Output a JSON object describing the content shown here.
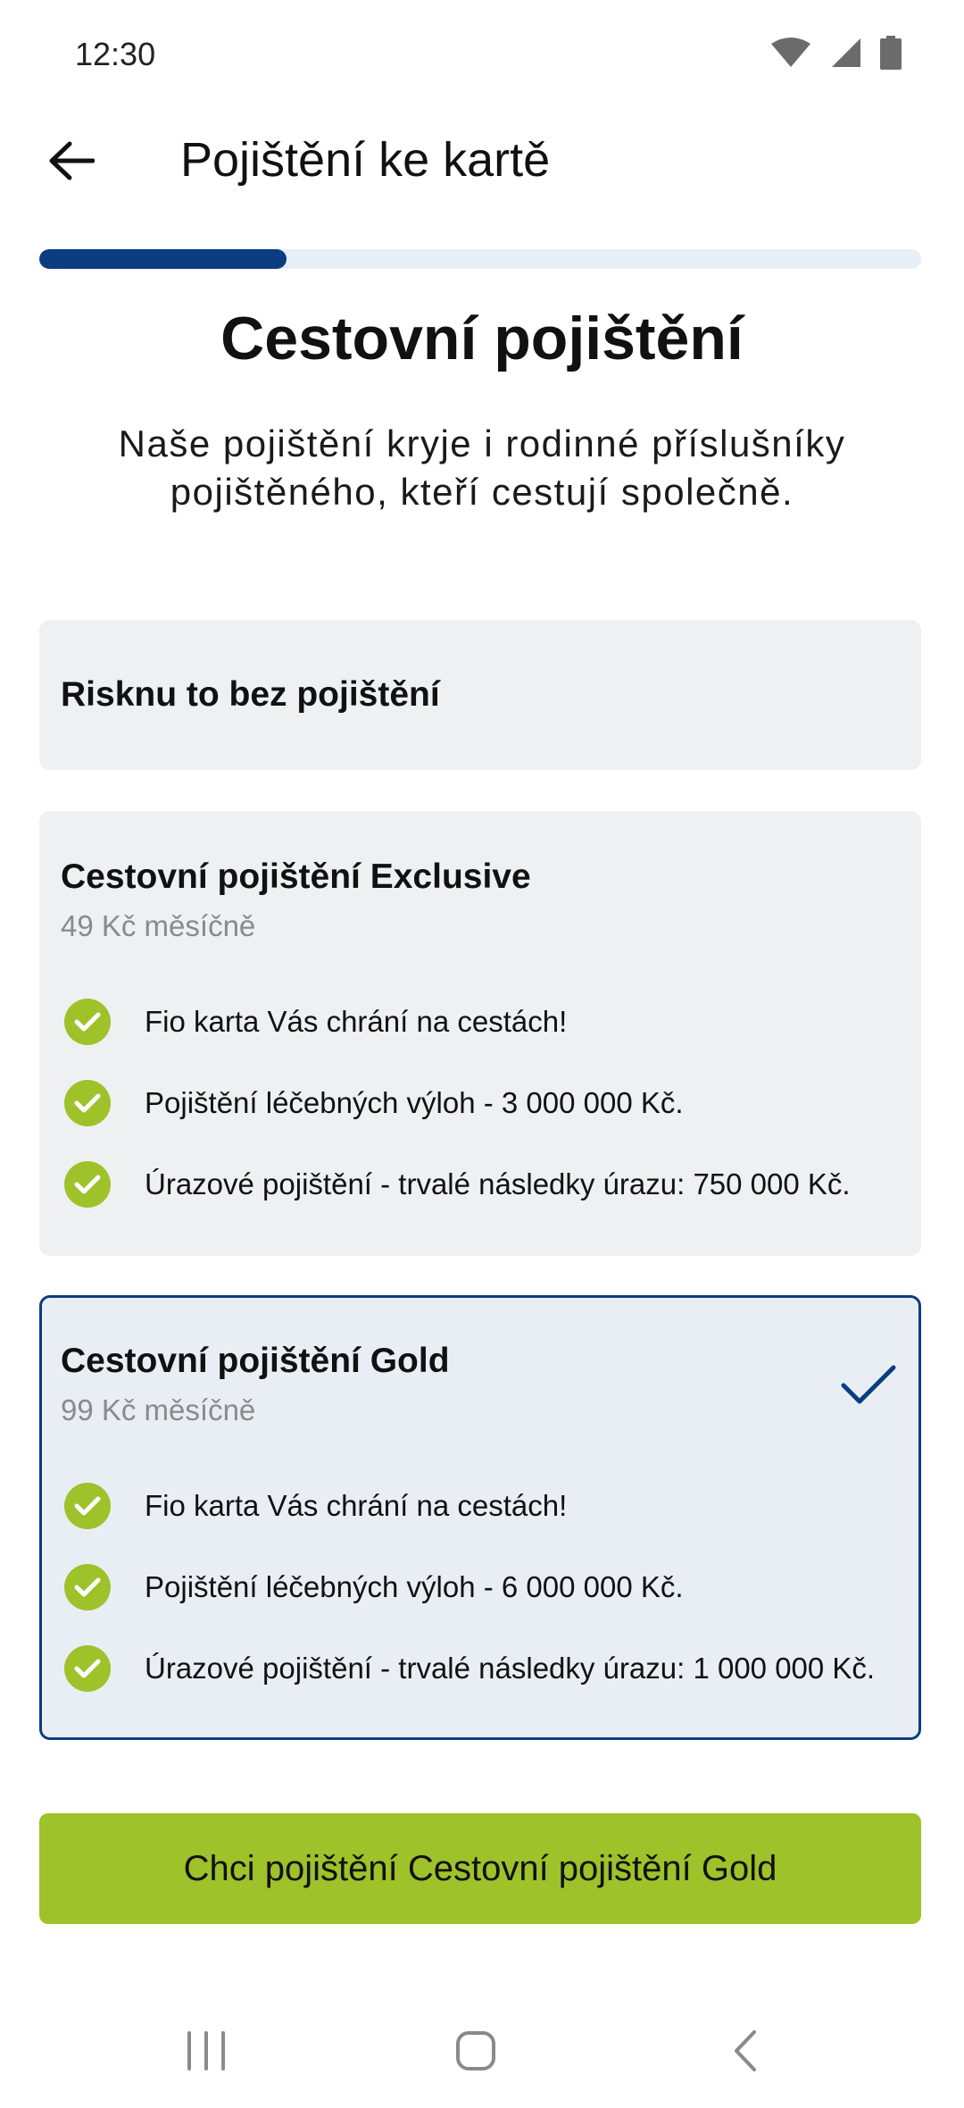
{
  "status_bar": {
    "time": "12:30",
    "icons": [
      "wifi-icon",
      "signal-icon",
      "battery-icon"
    ]
  },
  "app_bar": {
    "back_icon": "arrow-back-icon",
    "title": "Pojištění ke kartě"
  },
  "progress": {
    "fraction": 0.28,
    "fill_color": "#0a3d80",
    "track_color": "#e8eef5"
  },
  "heading": "Cestovní pojištění",
  "subheading": "Naše pojištění kryje i rodinné příslušníky pojištěného, kteří cestují společně.",
  "options": {
    "none": {
      "title": "Risknu to bez pojištění"
    },
    "exclusive": {
      "title": "Cestovní pojištění Exclusive",
      "price": "49 Kč měsíčně",
      "features": [
        "Fio karta Vás chrání na cestách!",
        "Pojištění léčebných výloh - 3 000 000 Kč.",
        "Úrazové pojištění - trvalé následky úrazu: 750 000 Kč."
      ]
    },
    "gold": {
      "title": "Cestovní pojištění Gold",
      "price": "99 Kč měsíčně",
      "selected": true,
      "features": [
        "Fio karta Vás chrání na cestách!",
        "Pojištění léčebných výloh - 6 000 000 Kč.",
        "Úrazové pojištění - trvalé následky úrazu:  1 000 000 Kč."
      ]
    }
  },
  "cta": {
    "label": "Chci pojištění Cestovní pojištění Gold"
  },
  "colors": {
    "accent_green": "#9ec229",
    "brand_blue": "#0a3d80",
    "card_bg": "#eff0f2",
    "selected_card_bg": "#e9eef5"
  },
  "nav_bar": {
    "icons": [
      "recent-apps-icon",
      "home-icon",
      "back-icon"
    ]
  }
}
